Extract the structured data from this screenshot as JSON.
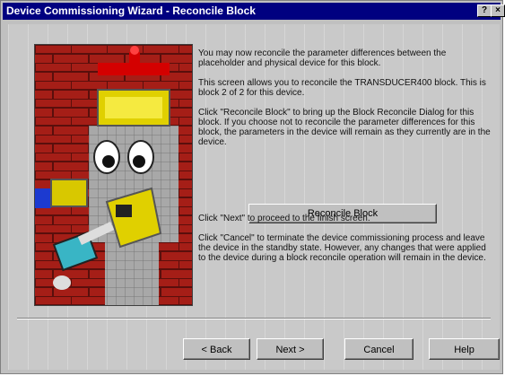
{
  "window": {
    "title": "Device Commissioning Wizard - Reconcile Block",
    "help_glyph": "?",
    "close_glyph": "×"
  },
  "body": {
    "paragraphs": [
      "You may now reconcile the parameter differences between the placeholder and physical device for this block.",
      "This screen allows you to reconcile the TRANSDUCER400 block. This is block 2 of 2 for this device.",
      "Click \"Reconcile Block\" to bring up the Block Reconcile Dialog for this block. If you choose not to reconcile the parameter differences for this block, the parameters in the device will remain as they currently are in the device."
    ],
    "reconcile_label": "Reconcile Block",
    "next_note": "Click \"Next\" to proceed to the finish screen.",
    "cancel_note": "Click \"Cancel\" to terminate the device commissioning process and leave the device in the standby state. However, any changes that were applied to the device during a block reconcile operation will remain in the device."
  },
  "buttons": {
    "back": "< Back",
    "next": "Next >",
    "cancel": "Cancel",
    "help": "Help"
  }
}
